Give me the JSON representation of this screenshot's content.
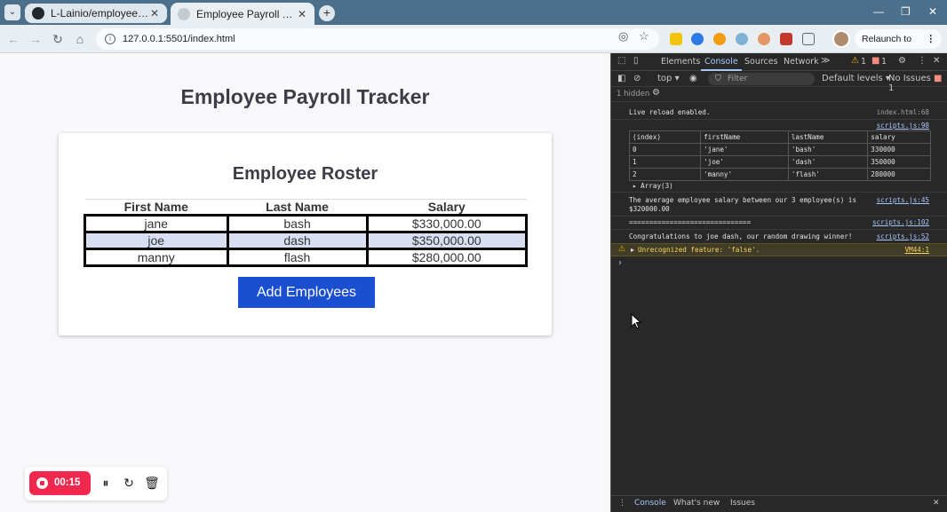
{
  "browser": {
    "tabs": [
      {
        "title": "L-Lainio/employeePayrollTracke",
        "active": false
      },
      {
        "title": "Employee Payroll Tracker",
        "active": true
      }
    ],
    "url": "127.0.0.1:5501/index.html",
    "relaunch_label": "Relaunch to update"
  },
  "page": {
    "title": "Employee Payroll Tracker",
    "roster_title": "Employee Roster",
    "columns": [
      "First Name",
      "Last Name",
      "Salary"
    ],
    "rows": [
      [
        "jane",
        "bash",
        "$330,000.00"
      ],
      [
        "joe",
        "dash",
        "$350,000.00"
      ],
      [
        "manny",
        "flash",
        "$280,000.00"
      ]
    ],
    "add_button": "Add Employees"
  },
  "recorder": {
    "time": "00:15"
  },
  "devtools": {
    "tabs": [
      "Elements",
      "Console",
      "Sources",
      "Network"
    ],
    "warn_count": "1",
    "issue_count": "1",
    "context": "top",
    "filter_placeholder": "Filter",
    "levels": "Default levels",
    "no_issues": "No Issues",
    "no_issues_count": "1",
    "hidden": "1 hidden",
    "messages": {
      "live_reload": "Live reload enabled.",
      "live_reload_src": "index.html:68",
      "table_src": "scripts.js:98",
      "table_headers": [
        "(index)",
        "firstName",
        "lastName",
        "salary"
      ],
      "table_rows": [
        [
          "0",
          "'jane'",
          "'bash'",
          "330000"
        ],
        [
          "1",
          "'joe'",
          "'dash'",
          "350000"
        ],
        [
          "2",
          "'manny'",
          "'flash'",
          "280000"
        ]
      ],
      "array_label": "Array(3)",
      "average_line1": "The average employee salary between our 3 employee(s) is",
      "average_line2": "$320000.00",
      "average_src": "scripts.js:45",
      "separator": "==============================",
      "separator_src": "scripts.js:102",
      "winner": "Congratulations to joe dash, our random drawing winner!",
      "winner_src": "scripts.js:52",
      "warning": "Unrecognized feature: 'false'.",
      "warning_src": "VM44:1"
    },
    "bottom_tabs": [
      "Console",
      "What's new",
      "Issues"
    ]
  },
  "colors": {
    "accent_button": "#1b4fd1",
    "tabstrip": "#4c6f8c",
    "record": "#f0284e"
  }
}
